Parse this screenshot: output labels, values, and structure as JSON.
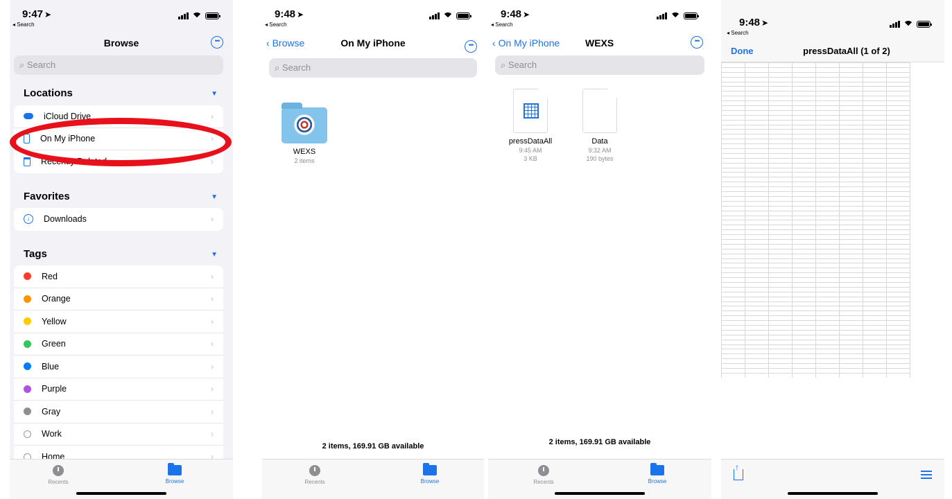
{
  "status": {
    "time1": "9:47",
    "time2": "9:48",
    "time3": "9:48",
    "time4": "9:48",
    "back": "◂ Search",
    "arrow": "➤"
  },
  "browse": {
    "title": "Browse",
    "search_placeholder": "Search",
    "locations_header": "Locations",
    "locations": [
      {
        "label": "iCloud Drive",
        "icon": "cloud-icon"
      },
      {
        "label": "On My iPhone",
        "icon": "phone-icon"
      },
      {
        "label": "Recently Deleted",
        "icon": "trash-icon"
      }
    ],
    "favorites_header": "Favorites",
    "favorites": [
      {
        "label": "Downloads",
        "icon": "download-icon"
      }
    ],
    "tags_header": "Tags",
    "tags": [
      {
        "label": "Red",
        "color": "#ff3b30"
      },
      {
        "label": "Orange",
        "color": "#ff9500"
      },
      {
        "label": "Yellow",
        "color": "#ffcc00"
      },
      {
        "label": "Green",
        "color": "#34c759"
      },
      {
        "label": "Blue",
        "color": "#007aff"
      },
      {
        "label": "Purple",
        "color": "#af52de"
      },
      {
        "label": "Gray",
        "color": "#8e8e93"
      },
      {
        "label": "Work",
        "color": ""
      },
      {
        "label": "Home",
        "color": ""
      }
    ]
  },
  "tabs": {
    "recents": "Recents",
    "browse": "Browse"
  },
  "onmyiphone": {
    "back": "Browse",
    "title": "On My iPhone",
    "search_placeholder": "Search",
    "folder": {
      "name": "WEXS",
      "sub": "2 items"
    },
    "footer": "2 items, 169.91 GB available"
  },
  "wexs": {
    "back": "On My iPhone",
    "title": "WEXS",
    "search_placeholder": "Search",
    "files": [
      {
        "name": "pressDataAll",
        "time": "9:45 AM",
        "size": "3 KB"
      },
      {
        "name": "Data",
        "time": "9:32 AM",
        "size": "190 bytes"
      }
    ],
    "footer": "2 items, 169.91 GB available"
  },
  "quicklook": {
    "done": "Done",
    "title": "pressDataAll (1 of 2)"
  },
  "accent": "#1a73e8",
  "annotation_color": "#e8101a"
}
